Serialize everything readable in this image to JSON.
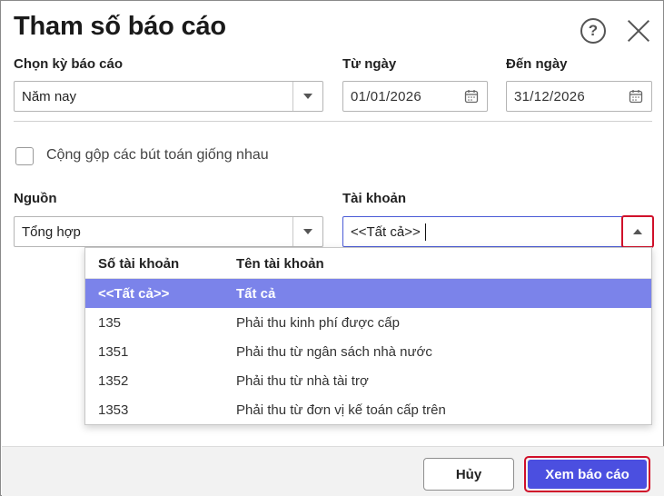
{
  "dialog": {
    "title": "Tham số báo cáo",
    "help_label": "?"
  },
  "period": {
    "label": "Chọn kỳ báo cáo",
    "value": "Năm nay"
  },
  "from_date": {
    "label": "Từ ngày",
    "value": "01/01/2026"
  },
  "to_date": {
    "label": "Đến ngày",
    "value": "31/12/2026"
  },
  "merge_option": {
    "label": "Cộng gộp các bút toán giống nhau",
    "checked": false
  },
  "source": {
    "label": "Nguồn",
    "value": "Tổng hợp"
  },
  "account": {
    "label": "Tài khoản",
    "value": "<<Tất cả>>"
  },
  "account_dropdown": {
    "columns": [
      "Số tài khoản",
      "Tên tài khoản"
    ],
    "rows": [
      {
        "code": "<<Tất cả>>",
        "name": "Tất cả",
        "selected": true
      },
      {
        "code": "135",
        "name": "Phải thu kinh phí được cấp",
        "selected": false
      },
      {
        "code": "1351",
        "name": "Phải thu từ ngân sách nhà nước",
        "selected": false
      },
      {
        "code": "1352",
        "name": "Phải thu từ nhà tài trợ",
        "selected": false
      },
      {
        "code": "1353",
        "name": "Phải thu từ đơn vị kế toán cấp trên",
        "selected": false
      }
    ]
  },
  "footer": {
    "cancel_label": "Hủy",
    "view_label": "Xem báo cáo"
  },
  "colors": {
    "primary": "#4b4fe0",
    "selected_row": "#7b83ea",
    "highlight_border": "#d0102a"
  },
  "icons": {
    "help": "help-circle-icon",
    "close": "close-icon",
    "calendar": "calendar-icon",
    "dropdown": "triangle-down-icon",
    "dropdown_open": "triangle-up-icon"
  }
}
